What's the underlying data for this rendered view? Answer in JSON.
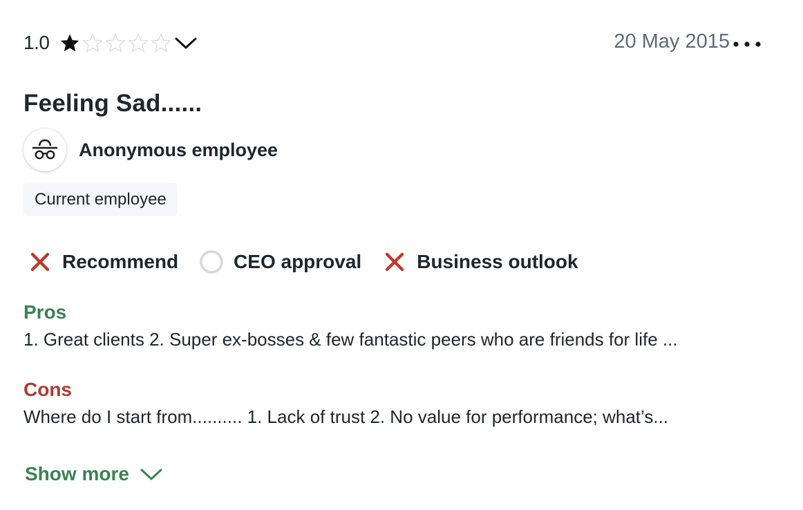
{
  "review": {
    "rating_value": "1.0",
    "rating_score": 1,
    "rating_max": 5,
    "date": "20 May 2015",
    "title": "Feeling Sad......",
    "author": "Anonymous employee",
    "employment_status": "Current employee",
    "indicators": [
      {
        "label": "Recommend",
        "status": "negative",
        "icon": "x-mark-icon"
      },
      {
        "label": "CEO approval",
        "status": "neutral",
        "icon": "empty-circle-icon"
      },
      {
        "label": "Business outlook",
        "status": "negative",
        "icon": "x-mark-icon"
      }
    ],
    "pros_label": "Pros",
    "pros_text": "1. Great clients 2. Super ex-bosses & few fantastic peers who are friends for life ...",
    "cons_label": "Cons",
    "cons_text": "Where do I start from.......... 1. Lack of trust 2. No value for performance; what’s...",
    "show_more_label": "Show more"
  },
  "icons": {
    "rating_toggle": "chevron-down-icon",
    "more_menu": "more-dots-icon",
    "avatar": "anonymous-incognito-icon",
    "show_more": "chevron-down-icon"
  },
  "colors": {
    "text": "#20262e",
    "muted": "#5d6a76",
    "positive_green": "#3a8251",
    "negative_red": "#b03a34",
    "x_mark": "#c0392b",
    "neutral_circle": "#d8d8d8",
    "chip_background": "#f5f6f7"
  }
}
